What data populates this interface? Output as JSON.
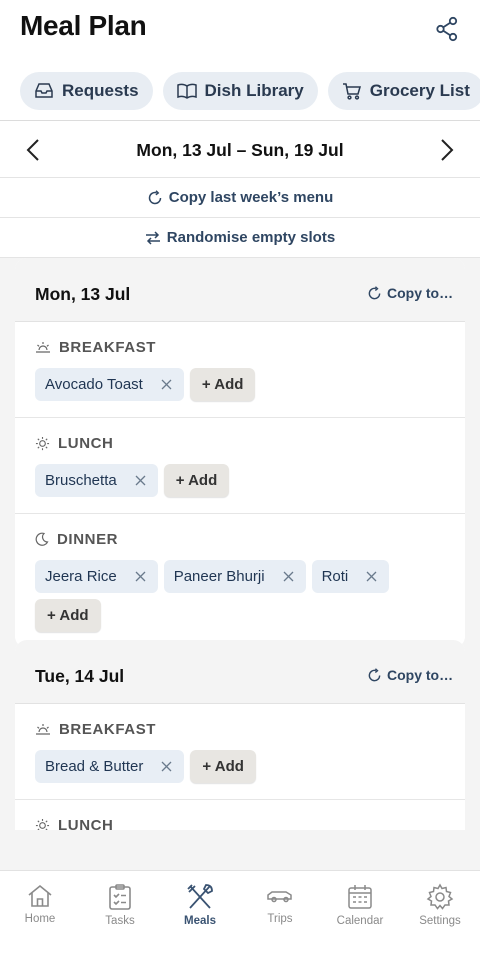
{
  "header": {
    "title": "Meal Plan",
    "share_icon": "share-icon"
  },
  "quick_links": [
    {
      "label": "Requests",
      "icon": "inbox-icon"
    },
    {
      "label": "Dish Library",
      "icon": "book-icon"
    },
    {
      "label": "Grocery List",
      "icon": "cart-icon"
    }
  ],
  "week": {
    "label": "Mon, 13 Jul – Sun, 19 Jul"
  },
  "actions": {
    "copy_last": "Copy last week’s menu",
    "randomise": "Randomise empty slots"
  },
  "days": [
    {
      "title": "Mon, 13 Jul",
      "copy_label": "Copy to…",
      "meals": [
        {
          "name": "BREAKFAST",
          "icon": "sunrise-icon",
          "dishes": [
            "Avocado Toast"
          ],
          "add_label": "+ Add"
        },
        {
          "name": "LUNCH",
          "icon": "sun-icon",
          "dishes": [
            "Bruschetta"
          ],
          "add_label": "+ Add"
        },
        {
          "name": "DINNER",
          "icon": "moon-icon",
          "dishes": [
            "Jeera Rice",
            "Paneer Bhurji",
            "Roti"
          ],
          "add_label": "+ Add"
        }
      ]
    },
    {
      "title": "Tue, 14 Jul",
      "copy_label": "Copy to…",
      "meals": [
        {
          "name": "BREAKFAST",
          "icon": "sunrise-icon",
          "dishes": [
            "Bread & Butter"
          ],
          "add_label": "+ Add"
        },
        {
          "name": "LUNCH",
          "icon": "sun-icon",
          "dishes": [],
          "add_label": ""
        }
      ]
    }
  ],
  "tabs": [
    {
      "label": "Home",
      "icon": "home-icon",
      "active": false
    },
    {
      "label": "Tasks",
      "icon": "clipboard-icon",
      "active": false
    },
    {
      "label": "Meals",
      "icon": "utensils-icon",
      "active": true
    },
    {
      "label": "Trips",
      "icon": "car-icon",
      "active": false
    },
    {
      "label": "Calendar",
      "icon": "calendar-icon",
      "active": false
    },
    {
      "label": "Settings",
      "icon": "gear-icon",
      "active": false
    }
  ],
  "colors": {
    "accent": "#3a5372",
    "chip_bg": "#e8eef5",
    "add_bg": "#e8e6e2",
    "page_bg": "#f4f4f4"
  }
}
